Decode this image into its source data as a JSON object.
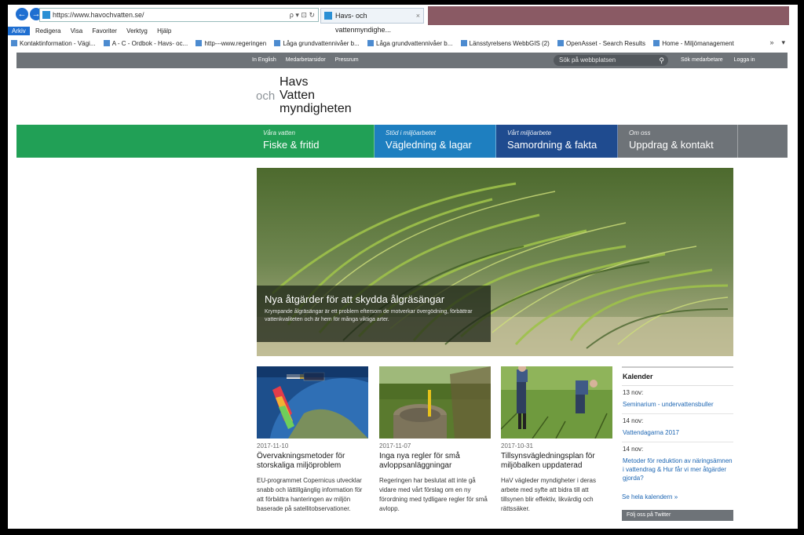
{
  "browser": {
    "back_glyph": "←",
    "forward_glyph": "→",
    "url": "https://www.havochvatten.se/",
    "address_tools": "ρ ▾ ⊡ ↻",
    "tab_title": "Havs- och vattenmyndighe...",
    "tab_close": "×",
    "menu": [
      "Arkiv",
      "Redigera",
      "Visa",
      "Favoriter",
      "Verktyg",
      "Hjälp"
    ],
    "favorites": [
      "Kontaktinformation - Vägi...",
      "A - C - Ordbok - Havs- oc...",
      "http---www.regeringen",
      "Låga grundvattennivåer b...",
      "Låga grundvattennivåer b...",
      "Länsstyrelsens WebbGIS (2)",
      "OpenAsset - Search Results",
      "Home - Miljömanagement"
    ],
    "favbar_overflow": "»",
    "favbar_tools": "▾"
  },
  "utility": {
    "links": [
      "In English",
      "Medarbetarsidor",
      "Pressrum"
    ],
    "search_placeholder": "Sök på webbplatsen",
    "search_icon": "⚲",
    "right": [
      "Sök medarbetare",
      "Logga in"
    ]
  },
  "logo": {
    "och": "och",
    "line1": "Havs",
    "line2": "Vatten",
    "line3": "myndigheten"
  },
  "nav": [
    {
      "small": "Våra vatten",
      "big": "Fiske & fritid"
    },
    {
      "small": "Stöd i miljöarbetet",
      "big": "Vägledning & lagar"
    },
    {
      "small": "Vårt miljöarbete",
      "big": "Samordning & fakta"
    },
    {
      "small": "Om oss",
      "big": "Uppdrag & kontakt"
    }
  ],
  "colors": {
    "green": "#21a056",
    "blue": "#1e7fc0",
    "navy": "#1f4b8f",
    "grey": "#6e7378"
  },
  "hero": {
    "title": "Nya åtgärder för att skydda ålgräsängar",
    "text": "Krympande ålgräsängar är ett problem eftersom de motverkar övergödning, förbättrar vattenkvaliteten och är hem för många viktiga arter."
  },
  "news": [
    {
      "date": "2017-11-10",
      "title": "Övervakningsmetoder för storskaliga miljöproblem",
      "body": "EU-programmet Copernicus utvecklar snabb och lättillgänglig information för att förbättra hanteringen av miljön baserade på satellitobservationer."
    },
    {
      "date": "2017-11-07",
      "title": "Inga nya regler för små avloppsanläggningar",
      "body": "Regeringen har beslutat att inte gå vidare med vårt förslag om en ny förordning med tydligare regler för små avlopp."
    },
    {
      "date": "2017-10-31",
      "title": "Tillsynsvägledningsplan för miljöbalken uppdaterad",
      "body": "HaV vägleder myndigheter i deras arbete med syfte att bidra till att tillsynen blir effektiv, likvärdig och rättssäker."
    }
  ],
  "calendar": {
    "heading": "Kalender",
    "events": [
      {
        "date": "13 nov:",
        "title": "Seminarium - undervattensbuller"
      },
      {
        "date": "14 nov:",
        "title": "Vattendagarna 2017"
      },
      {
        "date": "14 nov:",
        "title": "Metoder för reduktion av näringsämnen i vattendrag & Hur får vi mer åtgärder gjorda?"
      }
    ],
    "all_link": "Se hela kalendern »",
    "twitter": "Följ oss på Twitter"
  }
}
